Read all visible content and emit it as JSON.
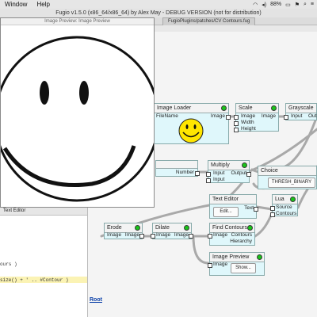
{
  "menubar": {
    "window_label": "Window",
    "help_label": "Help",
    "battery_label": "88%"
  },
  "window": {
    "title": "Fugio v1.5.0 (x86_64/x86_64) by Alex May - DEBUG VERSION (not for distribution)"
  },
  "preview": {
    "title": "Image Preview: Image Preview"
  },
  "tab": {
    "label": "FugioPlugins/patches/CV Contours.fug"
  },
  "editor": {
    "title": "Text Editor",
    "line1": "ours )",
    "line2": "size() + ' .. #Contour )"
  },
  "nodes": {
    "image_loader": {
      "title": "Image Loader",
      "pin_in": "FileName",
      "pin_out": "Image"
    },
    "scale": {
      "title": "Scale",
      "pins_in": [
        "Image",
        "Width",
        "Height"
      ],
      "pin_out": "Image"
    },
    "grayscale": {
      "title": "Grayscale",
      "pin_in": "Input",
      "pin_out": "Output"
    },
    "number": {
      "pin_out": "Number"
    },
    "multiply": {
      "title": "Multiply",
      "pins_in": [
        "Input",
        "Input"
      ],
      "pin_out": "Output"
    },
    "choice": {
      "title": "Choice",
      "value": "THRESH_BINARY"
    },
    "text_editor": {
      "title": "Text Editor",
      "button": "Edit...",
      "pin_out": "Text"
    },
    "lua": {
      "title": "Lua",
      "pins_in": [
        "Source",
        "Contours"
      ]
    },
    "erode": {
      "title": "Erode",
      "pin_in": "Image",
      "pin_out": "Image"
    },
    "dilate": {
      "title": "Dilate",
      "pin_in": "Image",
      "pin_out": "Image"
    },
    "find_contours": {
      "title": "Find Contours",
      "pin_in": "Image",
      "pins_out": [
        "Contours",
        "Hierarchy"
      ]
    },
    "image_preview": {
      "title": "Image Preview",
      "pin_in": "Image",
      "button": "Show..."
    }
  },
  "breadcrumb": {
    "root": "Root"
  },
  "colors": {
    "node_body": "#dff7fb",
    "led": "#19c419",
    "link": "#0a3fa8"
  }
}
